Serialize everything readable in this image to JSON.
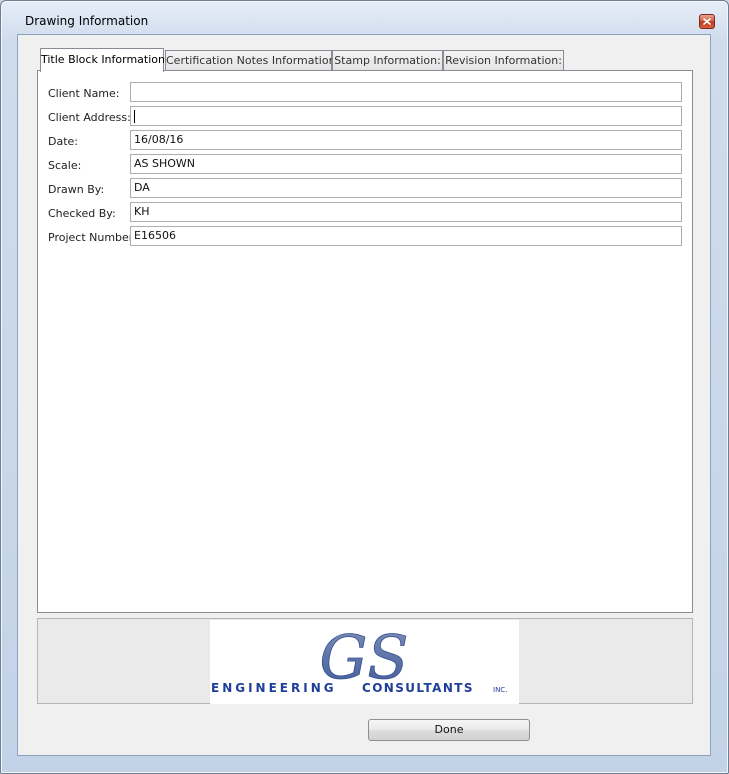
{
  "window": {
    "title": "Drawing Information"
  },
  "tabs": [
    {
      "label": "Title Block Information",
      "active": true
    },
    {
      "label": "Certification Notes Information",
      "active": false
    },
    {
      "label": "Stamp Information:",
      "active": false
    },
    {
      "label": "Revision Information:",
      "active": false
    }
  ],
  "fields": [
    {
      "label": "Client Name:",
      "value": ""
    },
    {
      "label": "Client Address:",
      "value": ""
    },
    {
      "label": "Date:",
      "value": "16/08/16"
    },
    {
      "label": "Scale:",
      "value": "AS SHOWN"
    },
    {
      "label": "Drawn By:",
      "value": "DA"
    },
    {
      "label": "Checked By:",
      "value": "KH"
    },
    {
      "label": "Project Number:",
      "value": "E16506"
    }
  ],
  "logo": {
    "monogram": "GS",
    "line_left": "ENGINEERING",
    "line_right": "CONSULTANTS",
    "suffix": "INC.",
    "color": "#1f3f9a"
  },
  "buttons": {
    "done": "Done"
  },
  "icons": {
    "close": "close-icon"
  }
}
